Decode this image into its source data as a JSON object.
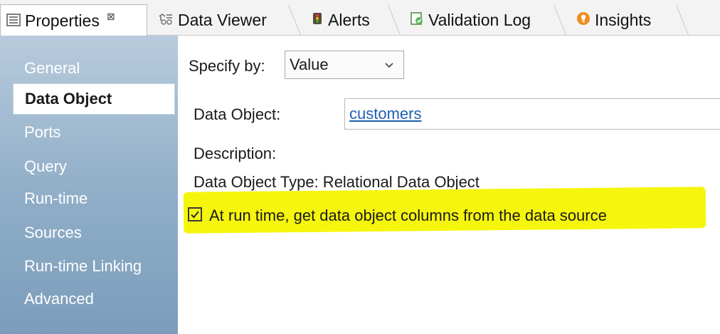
{
  "tabs": [
    {
      "label": "Properties",
      "close_glyph": "⊠",
      "icon": "properties-icon",
      "active": true
    },
    {
      "label": "Data Viewer",
      "icon": "data-viewer-icon",
      "active": false
    },
    {
      "label": "Alerts",
      "icon": "alerts-icon",
      "active": false
    },
    {
      "label": "Validation Log",
      "icon": "validation-log-icon",
      "active": false
    },
    {
      "label": "Insights",
      "icon": "insights-icon",
      "active": false
    }
  ],
  "sidebar": {
    "items": [
      {
        "label": "General"
      },
      {
        "label": "Data Object",
        "selected": true
      },
      {
        "label": "Ports"
      },
      {
        "label": "Query"
      },
      {
        "label": "Run-time"
      },
      {
        "label": "Sources"
      },
      {
        "label": "Run-time Linking"
      },
      {
        "label": "Advanced"
      }
    ]
  },
  "main": {
    "specify_by_label": "Specify by:",
    "specify_by_value": "Value",
    "data_object_label": "Data Object:",
    "data_object_value": "customers",
    "description_label": "Description:",
    "type_text": "Data Object Type: Relational Data Object",
    "runtime_columns_label": "At run time, get data object columns from the data source",
    "runtime_columns_checked": true
  },
  "colors": {
    "highlight": "#f6f60d",
    "link": "#1f5fb3",
    "sidebar_top": "#b7cbdc",
    "sidebar_bottom": "#7b9dbb",
    "insights_icon": "#f28c1c"
  }
}
